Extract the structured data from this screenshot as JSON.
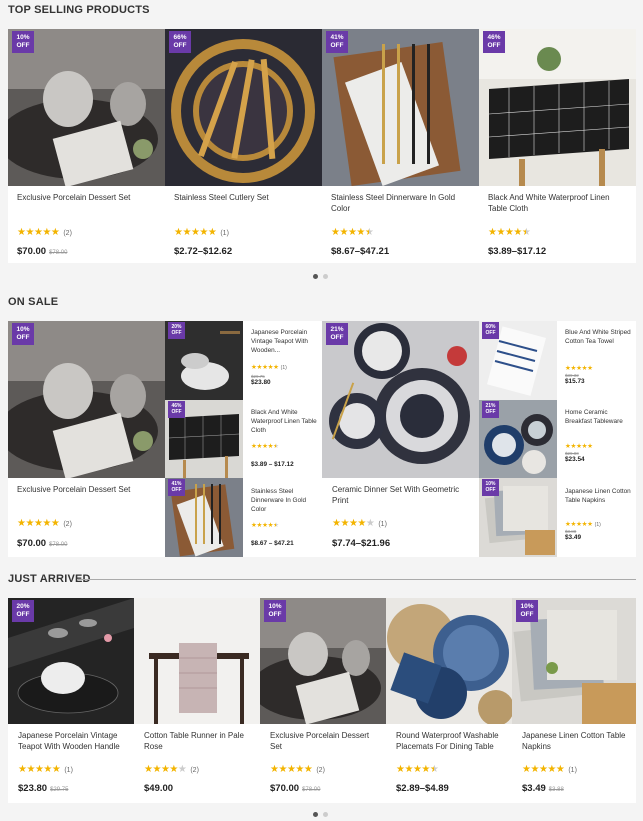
{
  "sections": {
    "top": "TOP SELLING PRODUCTS",
    "sale": "ON SALE",
    "arrived": "JUST ARRIVED"
  },
  "top_selling": [
    {
      "badge": "10%\nOFF",
      "name": "Exclusive Porcelain Dessert Set",
      "rating": 5,
      "count": "(2)",
      "price": "$70.00",
      "old_price": "$78.00"
    },
    {
      "badge": "66%\nOFF",
      "name": "Stainless Steel Cutlery Set",
      "rating": 5,
      "count": "(1)",
      "price": "$2.72–$12.62",
      "old_price": ""
    },
    {
      "badge": "41%\nOFF",
      "name": "Stainless Steel Dinnerware In Gold Color",
      "rating": 4.5,
      "count": "",
      "price": "$8.67–$47.21",
      "old_price": ""
    },
    {
      "badge": "46%\nOFF",
      "name": "Black And White Waterproof Linen Table Cloth",
      "rating": 4.5,
      "count": "",
      "price": "$3.89–$17.12",
      "old_price": ""
    }
  ],
  "on_sale": {
    "big_left": {
      "badge": "10%\nOFF",
      "name": "Exclusive Porcelain Dessert Set",
      "rating": 5,
      "count": "(2)",
      "price": "$70.00",
      "old_price": "$78.00"
    },
    "small_left": [
      {
        "badge": "20%\nOFF",
        "name": "Japanese Porcelain Vintage Teapot With Wooden...",
        "rating": 5,
        "count": "(1)",
        "price": "$23.80",
        "old_price": "$29.75"
      },
      {
        "badge": "46%\nOFF",
        "name": "Black And White Waterproof Linen Table Cloth",
        "rating": 4.5,
        "count": "",
        "price": "$3.89 – $17.12",
        "old_price": ""
      },
      {
        "badge": "41%\nOFF",
        "name": "Stainless Steel Dinnerware In Gold Color",
        "rating": 4.5,
        "count": "",
        "price": "$8.67 – $47.21",
        "old_price": ""
      }
    ],
    "big_right": {
      "badge": "21%\nOFF",
      "name": "Ceramic Dinner Set With Geometric Print",
      "rating": 4,
      "count": "(1)",
      "price": "$7.74–$21.96",
      "old_price": ""
    },
    "small_right": [
      {
        "badge": "60%\nOFF",
        "name": "Blue And White Striped Cotton Tea Towel",
        "rating": 5,
        "count": "",
        "price": "$15.73",
        "old_price": "$39.32"
      },
      {
        "badge": "21%\nOFF",
        "name": "Home Ceramic Breakfast Tableware",
        "rating": 5,
        "count": "",
        "price": "$23.54",
        "old_price": "$29.80"
      },
      {
        "badge": "10%\nOFF",
        "name": "Japanese Linen Cotton Table Napkins",
        "rating": 5,
        "count": "(1)",
        "price": "$3.49",
        "old_price": "$3.88"
      }
    ]
  },
  "just_arrived": [
    {
      "badge": "20%\nOFF",
      "name": "Japanese Porcelain Vintage Teapot With Wooden Handle",
      "rating": 5,
      "count": "(1)",
      "price": "$23.80",
      "old_price": "$29.75"
    },
    {
      "badge": "",
      "name": "Cotton Table Runner in Pale Rose",
      "rating": 4,
      "count": "(2)",
      "price": "$49.00",
      "old_price": ""
    },
    {
      "badge": "10%\nOFF",
      "name": "Exclusive Porcelain Dessert Set",
      "rating": 5,
      "count": "(2)",
      "price": "$70.00",
      "old_price": "$78.00"
    },
    {
      "badge": "",
      "name": "Round Waterproof Washable Placemats For Dining Table",
      "rating": 4.5,
      "count": "",
      "price": "$2.89–$4.89",
      "old_price": ""
    },
    {
      "badge": "10%\nOFF",
      "name": "Japanese Linen Cotton Table Napkins",
      "rating": 5,
      "count": "(1)",
      "price": "$3.49",
      "old_price": "$3.88"
    }
  ],
  "colors": {
    "badge": "#6a3aa8",
    "star": "#f3b400"
  }
}
